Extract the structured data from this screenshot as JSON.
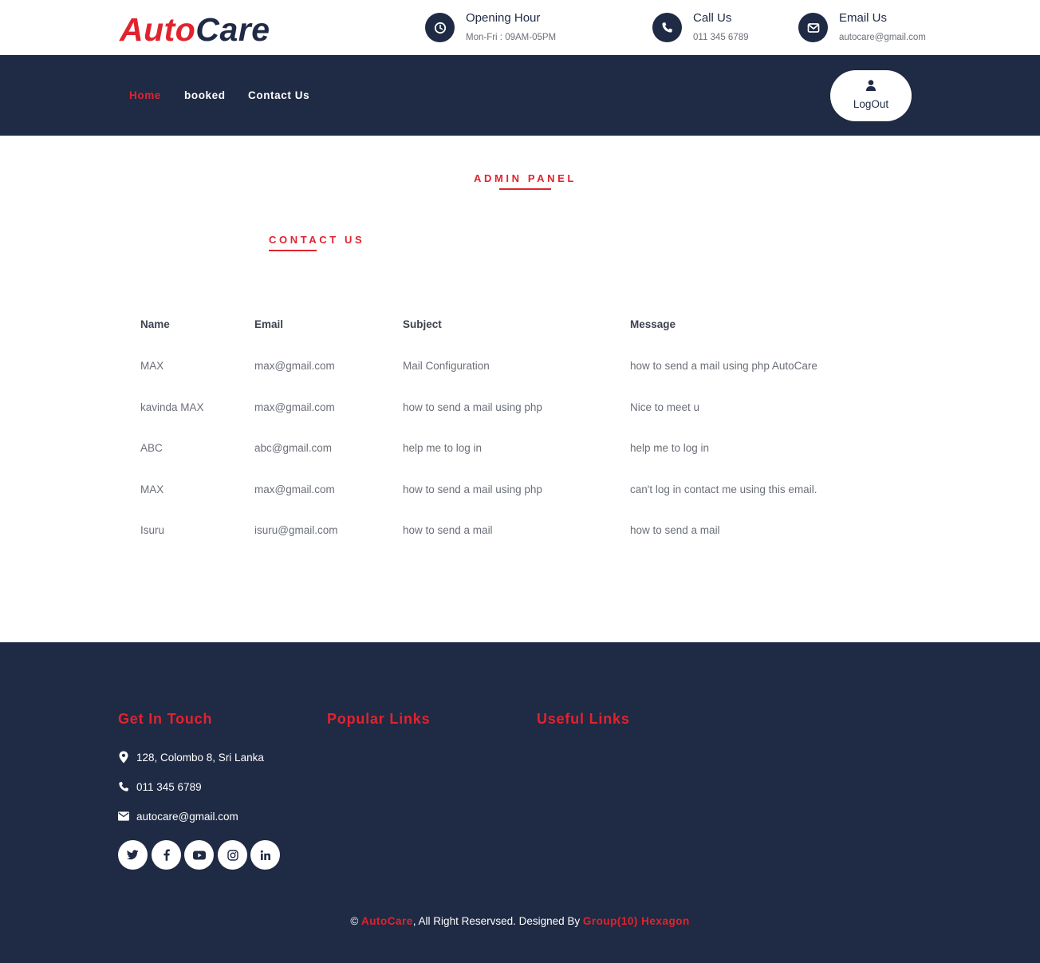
{
  "brand": {
    "part1": "Auto",
    "part2": "Care"
  },
  "topbar": {
    "opening": {
      "title": "Opening Hour",
      "value": "Mon-Fri : 09AM-05PM",
      "icon": "clock-icon"
    },
    "call": {
      "title": "Call Us",
      "value": "011 345 6789",
      "icon": "phone-icon"
    },
    "email": {
      "title": "Email Us",
      "value": "autocare@gmail.com",
      "icon": "envelope-icon"
    }
  },
  "nav": {
    "items": [
      {
        "label": "Home",
        "active": true
      },
      {
        "label": "booked",
        "active": false
      },
      {
        "label": "Contact Us",
        "active": false
      }
    ],
    "logout_label": "LogOut"
  },
  "admin_panel_title": "ADMIN PANEL",
  "contact_title": "CONTACT US",
  "table": {
    "headers": [
      "Name",
      "Email",
      "Subject",
      "Message"
    ],
    "rows": [
      [
        "MAX",
        "max@gmail.com",
        "Mail Configuration",
        "how to send a mail using php AutoCare"
      ],
      [
        "kavinda MAX",
        "max@gmail.com",
        "how to send a mail using php",
        "Nice to meet u"
      ],
      [
        "ABC",
        "abc@gmail.com",
        "help me to log in",
        "help me to log in"
      ],
      [
        "MAX",
        "max@gmail.com",
        "how to send a mail using php",
        "can't log in contact me using this email."
      ],
      [
        "Isuru",
        "isuru@gmail.com",
        "how to send a mail",
        "how to send a mail"
      ]
    ]
  },
  "footer": {
    "get_in_touch": "Get In Touch",
    "popular_links": "Popular Links",
    "useful_links": "Useful Links",
    "address": "128, Colombo 8, Sri Lanka",
    "phone": "011 345 6789",
    "email": "autocare@gmail.com",
    "social": [
      "twitter-icon",
      "facebook-icon",
      "youtube-icon",
      "instagram-icon",
      "linkedin-icon"
    ],
    "copyright": {
      "symbol": "©",
      "brand": "AutoCare",
      "middle": ", All Right Reservsed. Designed By",
      "designer": "Group(10) Hexagon"
    }
  },
  "colors": {
    "accent": "#e1232e",
    "navy": "#1f2a44",
    "text": "#6b6f78",
    "white": "#ffffff"
  }
}
